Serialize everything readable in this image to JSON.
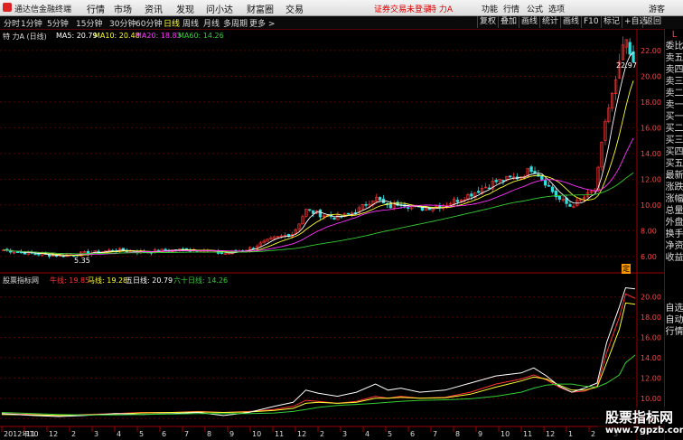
{
  "menubar": {
    "app_name": "通达信金融终端",
    "items": [
      "行情",
      "市场",
      "资讯",
      "发现",
      "问小达",
      "财富圈",
      "交易"
    ],
    "warning": "证券交易未登录",
    "stock": "特 力A",
    "right": [
      "功能",
      "行情",
      "公式",
      "选项",
      "游客"
    ]
  },
  "toolbar": {
    "periods": [
      "分时",
      "1分钟",
      "5分钟",
      "15分钟",
      "30分钟",
      "60分钟",
      "日线",
      "周线",
      "月线",
      "多周期",
      "更多 >"
    ],
    "active_period": "日线",
    "right_buttons": [
      "复权",
      "叠加",
      "画线",
      "统计",
      "画线",
      "F10",
      "标记",
      "+自选",
      "返回"
    ]
  },
  "main_info": {
    "stock_label": "特 力A (日线)",
    "ma5": "MA5: 20.79",
    "ma10": "MA10: 20.48",
    "ma20": "MA20: 18.83",
    "ma60": "MA60: 14.26"
  },
  "main_axis": {
    "ticks": [
      "22.00",
      "20.00",
      "18.00",
      "16.00",
      "14.00",
      "12.00",
      "10.00",
      "8.00",
      "6.00"
    ],
    "high_label": "22.97",
    "low_label": "5.35",
    "flag": "定"
  },
  "sub_info": {
    "name": "股票指标网",
    "l1": "牛线: 19.85",
    "l2": "马线: 19.28",
    "l3": "五日线: 20.79",
    "l4": "六十日线: 14.26"
  },
  "sub_axis": {
    "ticks": [
      "20.00",
      "18.00",
      "16.00",
      "14.00",
      "12.00",
      "10.00",
      "8.00"
    ]
  },
  "date_axis": {
    "labels": [
      "2012年10",
      "11",
      "12",
      "2",
      "3",
      "4",
      "5",
      "6",
      "7",
      "8",
      "9",
      "10",
      "11",
      "12",
      "2",
      "3",
      "4",
      "5",
      "6",
      "7",
      "8",
      "9",
      "10",
      "11",
      "12",
      "1",
      "2",
      "3"
    ]
  },
  "right_panel": {
    "top_labels": [
      "L",
      "委比",
      "卖五",
      "卖四",
      "卖三",
      "卖二",
      "卖一",
      "买一",
      "买二",
      "买三",
      "买四",
      "买五",
      "最新",
      "涨跌",
      "涨幅",
      "总量",
      "外盘",
      "换手",
      "净资",
      "收益"
    ],
    "bottom_labels": [
      "自选",
      "自动",
      "行情"
    ]
  },
  "watermark": {
    "title": "股票指标网",
    "url": "www.7gpzb.com"
  },
  "colors": {
    "up": "#ff3333",
    "down": "#33dddd",
    "ma5": "#ffffff",
    "ma10": "#ffff33",
    "ma20": "#ff33ff",
    "ma60": "#33cc33",
    "grid": "#5a0000"
  },
  "chart_data": {
    "type": "line",
    "price_range": [
      5.0,
      23.4
    ],
    "sub_range": [
      7.4,
      21.3
    ],
    "close_series": [
      {
        "t": 0,
        "v": 6.5
      },
      {
        "t": 0.05,
        "v": 6.2
      },
      {
        "t": 0.09,
        "v": 6.05
      },
      {
        "t": 0.13,
        "v": 6.25
      },
      {
        "t": 0.18,
        "v": 6.5
      },
      {
        "t": 0.22,
        "v": 6.35
      },
      {
        "t": 0.27,
        "v": 6.5
      },
      {
        "t": 0.31,
        "v": 6.55
      },
      {
        "t": 0.35,
        "v": 6.2
      },
      {
        "t": 0.39,
        "v": 6.6
      },
      {
        "t": 0.43,
        "v": 7.4
      },
      {
        "t": 0.46,
        "v": 7.8
      },
      {
        "t": 0.48,
        "v": 9.6
      },
      {
        "t": 0.5,
        "v": 9.3
      },
      {
        "t": 0.53,
        "v": 9.0
      },
      {
        "t": 0.56,
        "v": 9.5
      },
      {
        "t": 0.59,
        "v": 10.6
      },
      {
        "t": 0.61,
        "v": 9.8
      },
      {
        "t": 0.63,
        "v": 10.2
      },
      {
        "t": 0.66,
        "v": 9.7
      },
      {
        "t": 0.7,
        "v": 10.0
      },
      {
        "t": 0.74,
        "v": 10.8
      },
      {
        "t": 0.78,
        "v": 11.8
      },
      {
        "t": 0.82,
        "v": 12.2
      },
      {
        "t": 0.84,
        "v": 12.9
      },
      {
        "t": 0.86,
        "v": 11.8
      },
      {
        "t": 0.88,
        "v": 10.5
      },
      {
        "t": 0.9,
        "v": 9.9
      },
      {
        "t": 0.92,
        "v": 10.5
      },
      {
        "t": 0.94,
        "v": 11.2
      },
      {
        "t": 0.955,
        "v": 16.5
      },
      {
        "t": 0.975,
        "v": 20.0
      },
      {
        "t": 0.985,
        "v": 22.9
      },
      {
        "t": 1,
        "v": 20.8
      }
    ],
    "sub_series": [
      {
        "name": "牛线",
        "color": "#ff3333",
        "values": [
          8.5,
          8.4,
          8.3,
          8.4,
          8.5,
          8.6,
          8.6,
          8.7,
          8.6,
          8.7,
          8.9,
          9.2,
          9.8,
          9.7,
          9.5,
          9.7,
          10.2,
          10.0,
          10.2,
          10.0,
          10.1,
          10.6,
          11.4,
          11.9,
          12.3,
          11.8,
          11.1,
          10.6,
          10.7,
          11.2,
          14.5,
          18.0,
          20.3,
          19.85
        ]
      },
      {
        "name": "马线",
        "color": "#ffff33",
        "values": [
          8.4,
          8.35,
          8.3,
          8.35,
          8.45,
          8.55,
          8.6,
          8.65,
          8.6,
          8.65,
          8.8,
          9.0,
          9.5,
          9.6,
          9.5,
          9.6,
          10.0,
          10.0,
          10.1,
          10.0,
          10.05,
          10.4,
          11.1,
          11.7,
          12.1,
          11.9,
          11.3,
          10.8,
          10.8,
          11.1,
          13.5,
          16.8,
          19.4,
          19.28
        ]
      },
      {
        "name": "五日线",
        "color": "#ffffff",
        "values": [
          8.5,
          8.3,
          8.2,
          8.3,
          8.5,
          8.4,
          8.5,
          8.6,
          8.3,
          8.6,
          9.2,
          9.6,
          10.8,
          10.5,
          10.2,
          10.6,
          11.4,
          10.8,
          11.0,
          10.6,
          10.8,
          11.5,
          12.2,
          12.5,
          13.0,
          12.2,
          11.2,
          10.6,
          11.0,
          11.5,
          15.5,
          19.0,
          20.9,
          20.79
        ]
      },
      {
        "name": "六十日线",
        "color": "#33cc33",
        "values": [
          8.6,
          8.5,
          8.4,
          8.35,
          8.35,
          8.4,
          8.45,
          8.5,
          8.5,
          8.5,
          8.55,
          8.7,
          8.9,
          9.1,
          9.3,
          9.4,
          9.5,
          9.6,
          9.7,
          9.8,
          9.85,
          9.95,
          10.2,
          10.6,
          11.0,
          11.3,
          11.4,
          11.4,
          11.2,
          11.1,
          11.5,
          12.3,
          13.5,
          14.26
        ]
      }
    ]
  }
}
